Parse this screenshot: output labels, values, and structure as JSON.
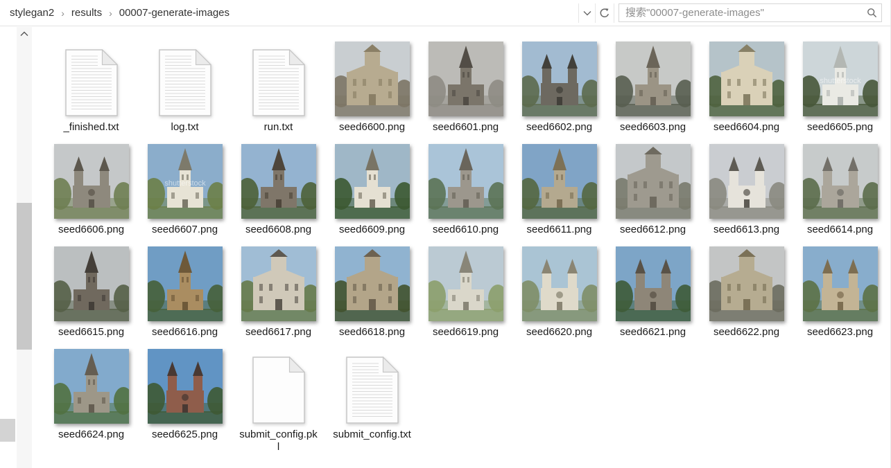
{
  "address_bar": {
    "breadcrumb": [
      {
        "label": "stylegan2"
      },
      {
        "label": "results"
      },
      {
        "label": "00007-generate-images"
      }
    ],
    "separator": "›",
    "search_placeholder": "搜索\"00007-generate-images\""
  },
  "icons": {
    "dropdown": "chevron-down",
    "refresh": "circular-arrow",
    "search": "magnifier",
    "scroll_up": "chevron-up"
  },
  "colors": {
    "label_text": "#1a1a1a",
    "placeholder_text": "#8c8c8c",
    "box_border": "#d6d6d6",
    "scrollbar_thumb": "#c8c8c8",
    "doc_line": "#dadada"
  },
  "files": [
    {
      "name": "_finished.txt",
      "kind": "text"
    },
    {
      "name": "log.txt",
      "kind": "text"
    },
    {
      "name": "run.txt",
      "kind": "text"
    },
    {
      "name": "seed6600.png",
      "kind": "image",
      "church": {
        "style": "facade",
        "sky": "#c9ced1",
        "wall": "#b7ab90",
        "dark": "#8a7f66",
        "green": "#7c7565"
      }
    },
    {
      "name": "seed6601.png",
      "kind": "image",
      "church": {
        "style": "central-spire",
        "sky": "#bcbbb7",
        "wall": "#7b756a",
        "dark": "#524d46",
        "green": "#8e8c84"
      }
    },
    {
      "name": "seed6602.png",
      "kind": "image",
      "church": {
        "style": "twin-towers",
        "sky": "#a2bbd1",
        "wall": "#6d6960",
        "dark": "#42403a",
        "green": "#5c6a4c"
      }
    },
    {
      "name": "seed6603.png",
      "kind": "image",
      "church": {
        "style": "central-spire",
        "sky": "#c7c9c7",
        "wall": "#9b9485",
        "dark": "#6b6559",
        "green": "#585e50"
      }
    },
    {
      "name": "seed6604.png",
      "kind": "image",
      "church": {
        "style": "facade",
        "sky": "#b5c3c9",
        "wall": "#dad1b8",
        "dark": "#878066",
        "green": "#4f633f"
      }
    },
    {
      "name": "seed6605.png",
      "kind": "image",
      "church": {
        "style": "central-spire",
        "sky": "#cdd6d9",
        "wall": "#eaeae4",
        "dark": "#b3b7b3",
        "green": "#475739",
        "watermark": "shutterstock"
      }
    },
    {
      "name": "seed6606.png",
      "kind": "image",
      "church": {
        "style": "twin-towers",
        "sky": "#c5c8c9",
        "wall": "#8e897d",
        "dark": "#5d584e",
        "green": "#6e7e52"
      }
    },
    {
      "name": "seed6607.png",
      "kind": "image",
      "church": {
        "style": "central-spire",
        "sky": "#8badcb",
        "wall": "#e7e3d5",
        "dark": "#7d7a6b",
        "green": "#6c7f48",
        "watermark": "shutterstock"
      }
    },
    {
      "name": "seed6608.png",
      "kind": "image",
      "church": {
        "style": "central-spire",
        "sky": "#94b3d0",
        "wall": "#7f7669",
        "dark": "#4e463b",
        "green": "#4d6137"
      }
    },
    {
      "name": "seed6609.png",
      "kind": "image",
      "church": {
        "style": "central-spire",
        "sky": "#9fb7c7",
        "wall": "#e5e0d2",
        "dark": "#797465",
        "green": "#3b5931"
      }
    },
    {
      "name": "seed6610.png",
      "kind": "image",
      "church": {
        "style": "central-spire",
        "sky": "#aac4d8",
        "wall": "#9c978d",
        "dark": "#6a655b",
        "green": "#5b7355"
      }
    },
    {
      "name": "seed6611.png",
      "kind": "image",
      "church": {
        "style": "central-spire",
        "sky": "#80a4c6",
        "wall": "#b4a98f",
        "dark": "#7d7156",
        "green": "#546740"
      }
    },
    {
      "name": "seed6612.png",
      "kind": "image",
      "church": {
        "style": "facade",
        "sky": "#c4c8ca",
        "wall": "#9e9a8f",
        "dark": "#6e6a5f",
        "green": "#797a6d"
      }
    },
    {
      "name": "seed6613.png",
      "kind": "image",
      "church": {
        "style": "twin-towers",
        "sky": "#cacdd1",
        "wall": "#e6e3db",
        "dark": "#5e5b54",
        "green": "#89897f"
      }
    },
    {
      "name": "seed6614.png",
      "kind": "image",
      "church": {
        "style": "twin-towers",
        "sky": "#c7cbcb",
        "wall": "#aba69b",
        "dark": "#737069",
        "green": "#5b6d4b"
      }
    },
    {
      "name": "seed6615.png",
      "kind": "image",
      "church": {
        "style": "central-spire",
        "sky": "#bbbfc0",
        "wall": "#70695e",
        "dark": "#443f39",
        "green": "#555f47"
      }
    },
    {
      "name": "seed6616.png",
      "kind": "image",
      "church": {
        "style": "central-spire",
        "sky": "#709dc4",
        "wall": "#aa8d61",
        "dark": "#6e5939",
        "green": "#46603a"
      }
    },
    {
      "name": "seed6617.png",
      "kind": "image",
      "church": {
        "style": "facade",
        "sky": "#a0bdd5",
        "wall": "#d0c9b9",
        "dark": "#5e5950",
        "green": "#667a4a"
      }
    },
    {
      "name": "seed6618.png",
      "kind": "image",
      "church": {
        "style": "facade",
        "sky": "#90b3d0",
        "wall": "#b3a589",
        "dark": "#6d6250",
        "green": "#41522e"
      }
    },
    {
      "name": "seed6619.png",
      "kind": "image",
      "church": {
        "style": "central-spire",
        "sky": "#bbcad3",
        "wall": "#dad7ca",
        "dark": "#898678",
        "green": "#8c9f6b"
      }
    },
    {
      "name": "seed6620.png",
      "kind": "image",
      "church": {
        "style": "twin-towers",
        "sky": "#aac4d4",
        "wall": "#dfdaca",
        "dark": "#8a8573",
        "green": "#7e8e67"
      }
    },
    {
      "name": "seed6621.png",
      "kind": "image",
      "church": {
        "style": "twin-towers",
        "sky": "#7da5c7",
        "wall": "#8e8678",
        "dark": "#595247",
        "green": "#3e5b37"
      }
    },
    {
      "name": "seed6622.png",
      "kind": "image",
      "church": {
        "style": "facade",
        "sky": "#c3c5c5",
        "wall": "#b6ac91",
        "dark": "#7b7157",
        "green": "#6c6c5e"
      }
    },
    {
      "name": "seed6623.png",
      "kind": "image",
      "church": {
        "style": "twin-towers",
        "sky": "#88adcc",
        "wall": "#c3b495",
        "dark": "#7d6e51",
        "green": "#5c7146"
      }
    },
    {
      "name": "seed6624.png",
      "kind": "image",
      "church": {
        "style": "central-spire",
        "sky": "#82aacc",
        "wall": "#9d9788",
        "dark": "#655e52",
        "green": "#517141"
      }
    },
    {
      "name": "seed6625.png",
      "kind": "image",
      "church": {
        "style": "twin-towers",
        "sky": "#6194c4",
        "wall": "#8f5d4b",
        "dark": "#493933",
        "green": "#3e5934"
      }
    },
    {
      "name": "submit_config.pkl",
      "kind": "blank"
    },
    {
      "name": "submit_config.txt",
      "kind": "text"
    }
  ]
}
